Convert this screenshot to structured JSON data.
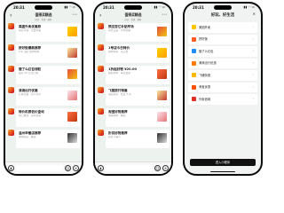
{
  "statusbar": {
    "time": "20:31",
    "icons": "▮▮ ◠ ▭"
  },
  "chat": {
    "title": "值得买精选",
    "subtitle": "好价 · 优惠 · 爆料",
    "phone1": [
      {
        "title": "美团外卖优惠券",
        "sub": "每日可领 · 点击查看"
      },
      {
        "title": "拼好饭爆款推荐",
        "sub": "9.9 元起 限时抢购"
      },
      {
        "title": "饿了么红包领取",
        "sub": "最高 20 元无门槛"
      },
      {
        "title": "滴滴出行优惠",
        "sub": "打车立减 · 新人专享"
      },
      {
        "title": "特价机票低价查询",
        "sub": "热门航线 · 实时更新"
      },
      {
        "title": "温州早餐店推荐",
        "sub": "本地好店 · 精选"
      }
    ],
    "phone2": [
      {
        "title": "预见百亿补贴专场",
        "sub": "官方正品 · 全场包邮"
      },
      {
        "title": "1号店今日特价",
        "sub": "限时秒杀 · 马上抢"
      },
      {
        "title": "1折起好物 ¥20.00",
        "sub": "超值清单 · 每日更新"
      },
      {
        "title": "飞猪旅行特惠",
        "sub": "酒店机票 · 低至 5 折"
      },
      {
        "title": "淘宝好物推荐",
        "sub": "热销榜单 · 精选"
      },
      {
        "title": "折扣好物推荐",
        "sub": "好价不等人"
      }
    ]
  },
  "menu": {
    "title": "好玩、好生活",
    "close": "×",
    "items": [
      {
        "label": "美团外卖",
        "color": "#ffc300"
      },
      {
        "label": "拼好饭",
        "color": "#ff5a1f"
      },
      {
        "label": "饿了么红包",
        "color": "#1e8bff"
      },
      {
        "label": "滴滴出行优惠",
        "color": "#ff7a00"
      },
      {
        "label": "飞猪特惠",
        "color": "#ffb800"
      },
      {
        "label": "淘宝优惠",
        "color": "#ff5000"
      },
      {
        "label": "外卖官网",
        "color": "#e02e24"
      }
    ],
    "button": "进入小程序",
    "chevron": "›"
  }
}
